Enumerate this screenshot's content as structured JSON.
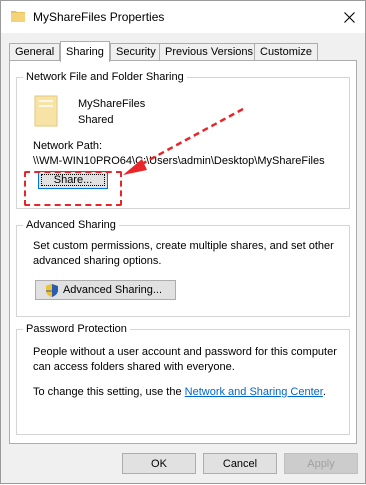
{
  "window": {
    "title": "MyShareFiles Properties"
  },
  "tabs": [
    {
      "label": "General"
    },
    {
      "label": "Sharing"
    },
    {
      "label": "Security"
    },
    {
      "label": "Previous Versions"
    },
    {
      "label": "Customize"
    }
  ],
  "network_sharing": {
    "group_title": "Network File and Folder Sharing",
    "folder_name": "MyShareFiles",
    "folder_status": "Shared",
    "path_label": "Network Path:",
    "path_value": "\\\\WM-WIN10PRO64\\C:\\Users\\admin\\Desktop\\MyShareFiles",
    "share_button": "Share..."
  },
  "advanced_sharing": {
    "group_title": "Advanced Sharing",
    "description_line1": "Set custom permissions, create multiple shares, and set other",
    "description_line2": "advanced sharing options.",
    "button": "Advanced Sharing..."
  },
  "password_protection": {
    "group_title": "Password Protection",
    "description_line1": "People without a user account and password for this computer",
    "description_line2": "can access folders shared with everyone.",
    "change_text": "To change this setting, use the ",
    "link_text": "Network and Sharing Center",
    "change_suffix": "."
  },
  "footer": {
    "ok": "OK",
    "cancel": "Cancel",
    "apply": "Apply"
  },
  "colors": {
    "annotation": "#e8262a",
    "link": "#0066cc",
    "folder": "#e8c35a"
  },
  "icons": {
    "title": "folder-icon",
    "folder": "folder-icon",
    "shield": "uac-shield-icon",
    "close": "close-icon"
  }
}
